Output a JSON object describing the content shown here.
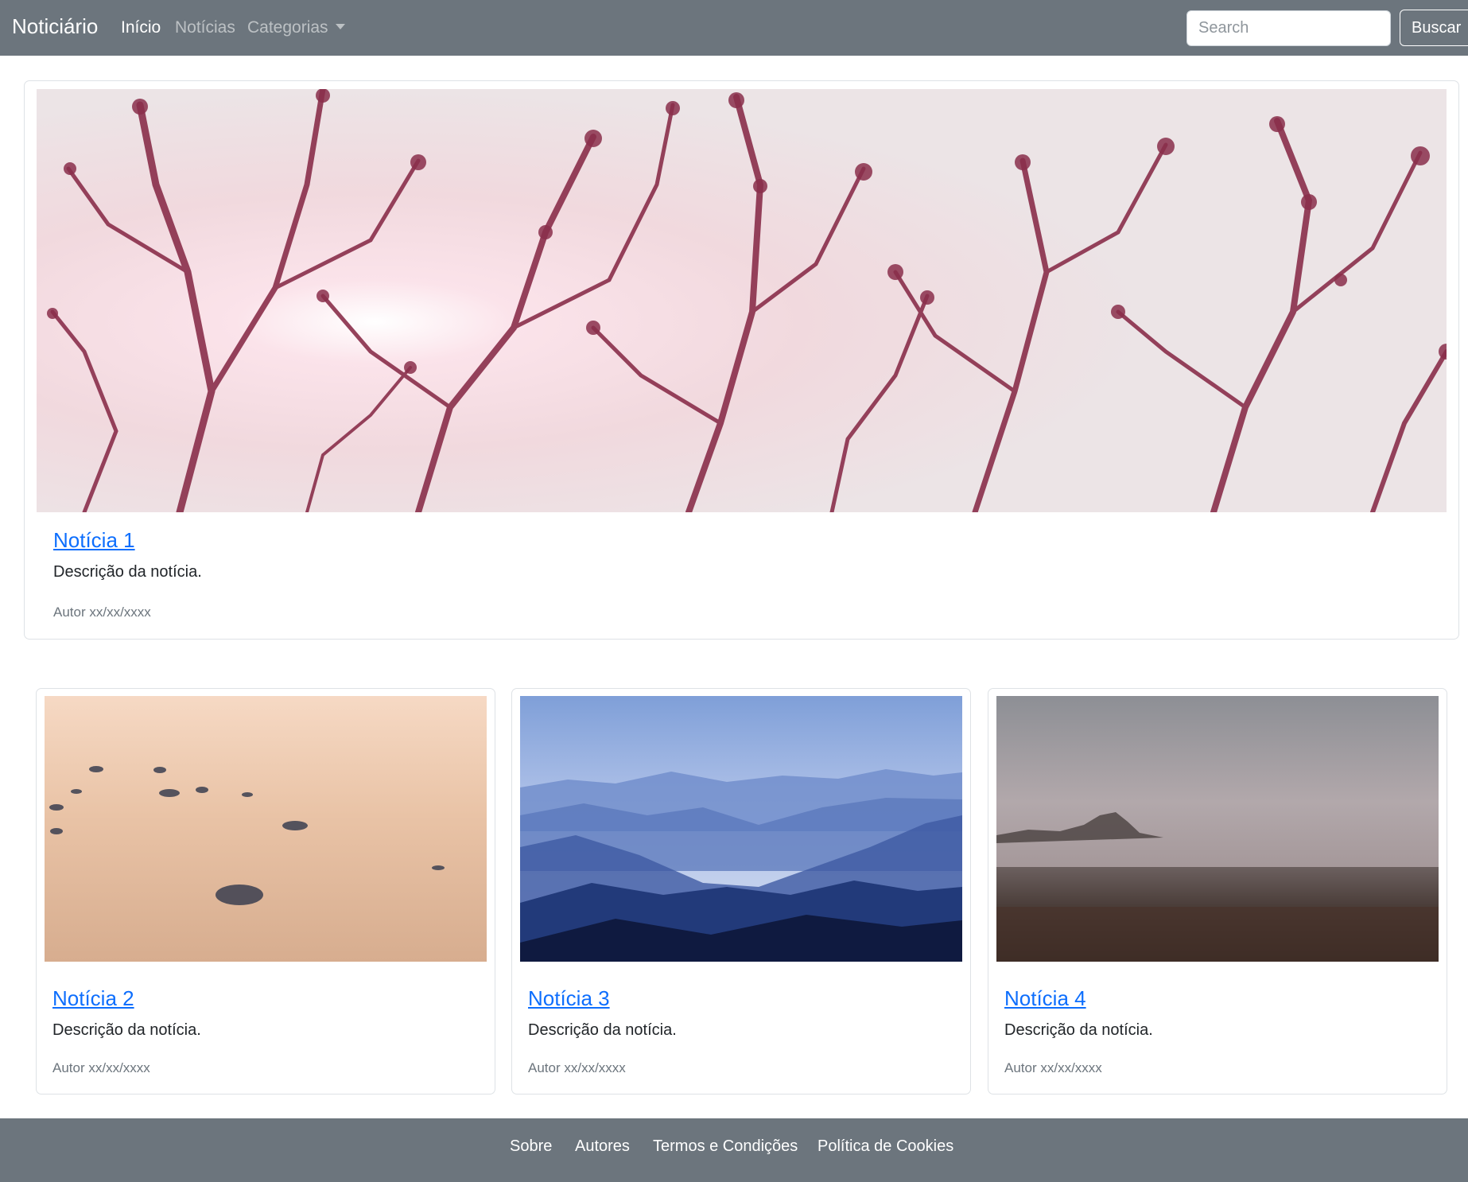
{
  "navbar": {
    "brand": "Noticiário",
    "links": [
      "Início",
      "Notícias",
      "Categorias"
    ],
    "search_placeholder": "Search",
    "search_value": "",
    "search_button": "Buscar"
  },
  "featured": {
    "title": "Notícia 1",
    "description": "Descrição da notícia.",
    "meta": "Autor xx/xx/xxxx",
    "image": "branches-against-pink-sky"
  },
  "cards": [
    {
      "title": "Notícia 2",
      "description": "Descrição da notícia.",
      "meta": "Autor xx/xx/xxxx",
      "image": "pebbles-on-sand"
    },
    {
      "title": "Notícia 3",
      "description": "Descrição da notícia.",
      "meta": "Autor xx/xx/xxxx",
      "image": "blue-misty-mountains"
    },
    {
      "title": "Notícia 4",
      "description": "Descrição da notícia.",
      "meta": "Autor xx/xx/xxxx",
      "image": "foggy-field"
    }
  ],
  "footer": {
    "links": [
      "Sobre",
      "Autores",
      "Termos e Condições",
      "Política de Cookies"
    ]
  },
  "colors": {
    "navbar_bg": "#6c757d",
    "link": "#0d6efd",
    "muted": "#6c757d"
  }
}
